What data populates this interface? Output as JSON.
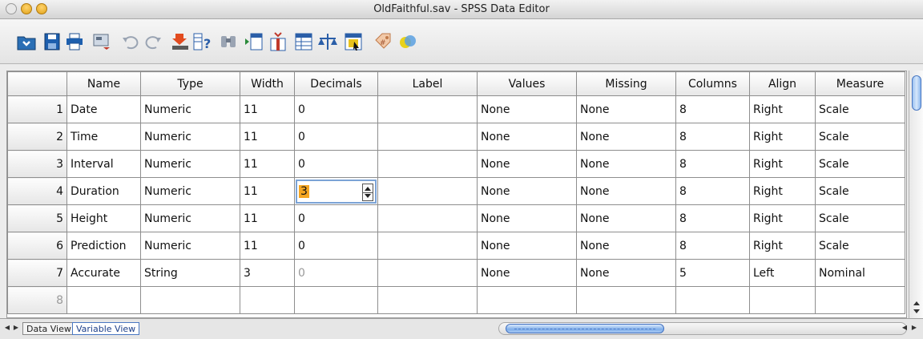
{
  "window": {
    "title": "OldFaithful.sav - SPSS Data Editor"
  },
  "toolbar": {
    "icons": [
      "open-folder-icon",
      "save-icon",
      "print-icon",
      "dialog-recall-icon",
      "undo-icon",
      "redo-icon",
      "goto-case-icon",
      "variables-icon",
      "find-icon",
      "insert-cases-icon",
      "insert-variable-icon",
      "split-file-icon",
      "weight-cases-icon",
      "select-cases-icon",
      "value-labels-icon",
      "use-sets-icon"
    ]
  },
  "grid": {
    "columns": [
      "Name",
      "Type",
      "Width",
      "Decimals",
      "Label",
      "Values",
      "Missing",
      "Columns",
      "Align",
      "Measure"
    ],
    "rows": [
      {
        "num": "1",
        "name": "Date",
        "type": "Numeric",
        "width": "11",
        "decimals": "0",
        "label": "",
        "values": "None",
        "missing": "None",
        "columns": "8",
        "align": "Right",
        "measure": "Scale"
      },
      {
        "num": "2",
        "name": "Time",
        "type": "Numeric",
        "width": "11",
        "decimals": "0",
        "label": "",
        "values": "None",
        "missing": "None",
        "columns": "8",
        "align": "Right",
        "measure": "Scale"
      },
      {
        "num": "3",
        "name": "Interval",
        "type": "Numeric",
        "width": "11",
        "decimals": "0",
        "label": "",
        "values": "None",
        "missing": "None",
        "columns": "8",
        "align": "Right",
        "measure": "Scale"
      },
      {
        "num": "4",
        "name": "Duration",
        "type": "Numeric",
        "width": "11",
        "decimals": "3",
        "label": "",
        "values": "None",
        "missing": "None",
        "columns": "8",
        "align": "Right",
        "measure": "Scale"
      },
      {
        "num": "5",
        "name": "Height",
        "type": "Numeric",
        "width": "11",
        "decimals": "0",
        "label": "",
        "values": "None",
        "missing": "None",
        "columns": "8",
        "align": "Right",
        "measure": "Scale"
      },
      {
        "num": "6",
        "name": "Prediction",
        "type": "Numeric",
        "width": "11",
        "decimals": "0",
        "label": "",
        "values": "None",
        "missing": "None",
        "columns": "8",
        "align": "Right",
        "measure": "Scale"
      },
      {
        "num": "7",
        "name": "Accurate",
        "type": "String",
        "width": "3",
        "decimals": "0",
        "label": "",
        "values": "None",
        "missing": "None",
        "columns": "5",
        "align": "Left",
        "measure": "Nominal"
      }
    ],
    "empty_row_num": "8",
    "editing": {
      "row": 4,
      "column": "Decimals",
      "value": "3"
    }
  },
  "tabs": {
    "data_view": "Data View",
    "variable_view": "Variable View",
    "active": "variable_view"
  },
  "colors": {
    "accent": "#4a78c2",
    "edit_highlight": "#f5a623"
  }
}
